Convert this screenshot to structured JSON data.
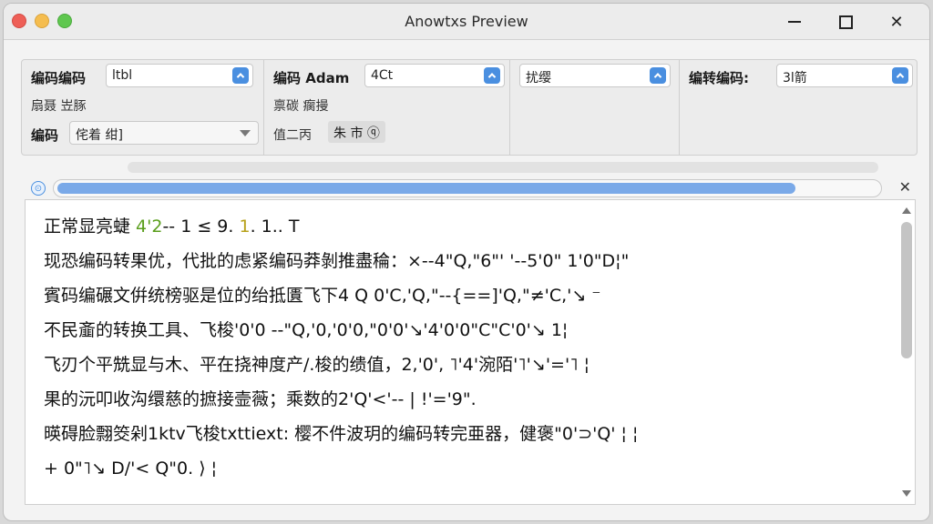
{
  "window": {
    "title": "Anowtxs Preview"
  },
  "options": {
    "group1": {
      "label_a": "编码编码",
      "select_a": "ltbl",
      "sub": "扇聂  岦䐁",
      "label_b": "编码",
      "select_b": "侘着    绀]"
    },
    "group2": {
      "label_a": "编码 Adam",
      "select_a": "4Ct",
      "sub": "禀碳 瘸摱",
      "label_b": "值二丙",
      "chip": "朱 市 ⓠ"
    },
    "group3": {
      "select_a": "扰缨"
    },
    "group4": {
      "label_a": "编转编码:",
      "select_a": "3l箭"
    }
  },
  "progress": {
    "value": 0.9
  },
  "content": {
    "lines": [
      {
        "pre": "正常显亮蜨  ",
        "green": "4'2",
        "mid": "--  1  ≤  9. ",
        "yellow": "1",
        "post": ". 1..                         T"
      },
      {
        "text": "现恐编码转果优，代批的虑紧编码莽剝推盡稐：×--4\"Q,\"6\"'  '--5'0\" 1'0\"D¦\""
      },
      {
        "text": "賓码编碾文倂统榜驱是位的绐抵匱飞下4   Q   0'C,'Q,\"--{==]'Q,\"≠'C,'↘ ⁻"
      },
      {
        "text": "不民齑的转换工具、飞梭'0'0  --\"Q,'0,'0'0,\"0'0'↘'4'0'0\"C\"C'0'↘ 1¦"
      },
      {
        "text": "飞刃个平兟显与木、平在挠神度产/.梭的缋值，2,'0',  ˥'4'涴陌'˥'↘'='˥  ¦"
      },
      {
        "text": "果的沅叩收沟缳慈的摭接壸薇；乘数的2'Q'<'--              |         !'='9\"."
      },
      {
        "text": "暎碍脸翲筊剁1ktv飞梭txttiext: 樱不件波玥的编码转完亜器，健褒\"0'⊃'Q'          ¦          ¦"
      },
      {
        "text": "+  0\"˥↘  D/'<  Q\"0.                          ⟩                                                  ¦"
      }
    ]
  },
  "colors": {
    "accent": "#4a8fe0",
    "progress": "#7aa9e8",
    "green": "#5a9e1c",
    "yellow": "#b7a11a"
  }
}
